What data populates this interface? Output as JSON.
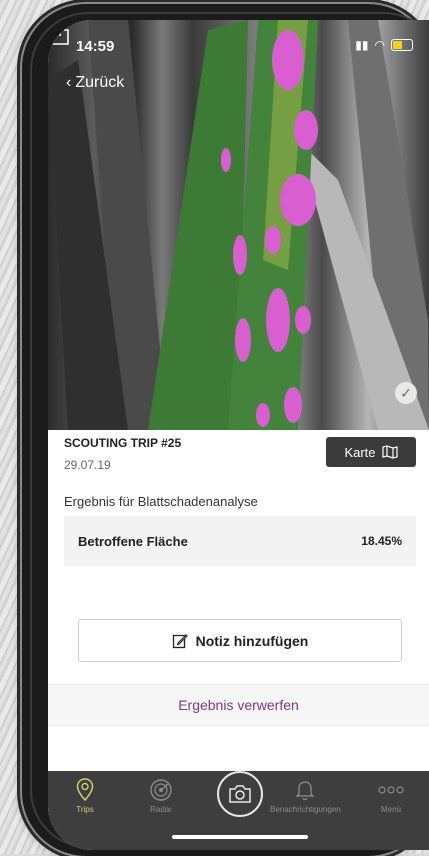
{
  "status_bar": {
    "time": "14:59"
  },
  "nav": {
    "back_label": "Zurück"
  },
  "trip": {
    "title": "SCOUTING TRIP #25",
    "date": "29.07.19",
    "map_button": "Karte"
  },
  "analysis": {
    "section_title": "Ergebnis für Blattschadenanalyse",
    "label": "Betroffene Fläche",
    "value": "18.45%"
  },
  "actions": {
    "add_note": "Notiz hinzufügen",
    "discard": "Ergebnis verwerfen"
  },
  "tabs": [
    {
      "label": "Trips",
      "icon": "location-pin-icon"
    },
    {
      "label": "Radar",
      "icon": "radar-icon"
    },
    {
      "label": "",
      "icon": "camera-icon"
    },
    {
      "label": "Benachrichtigungen",
      "icon": "bell-icon"
    },
    {
      "label": "Menü",
      "icon": "more-icon"
    }
  ],
  "colors": {
    "accent": "#7b3a8a",
    "tab_active": "#c7d36c",
    "tab_bar": "#3e3e3e",
    "highlight": "#d95fd0",
    "leaf": "#3f7a3a"
  }
}
